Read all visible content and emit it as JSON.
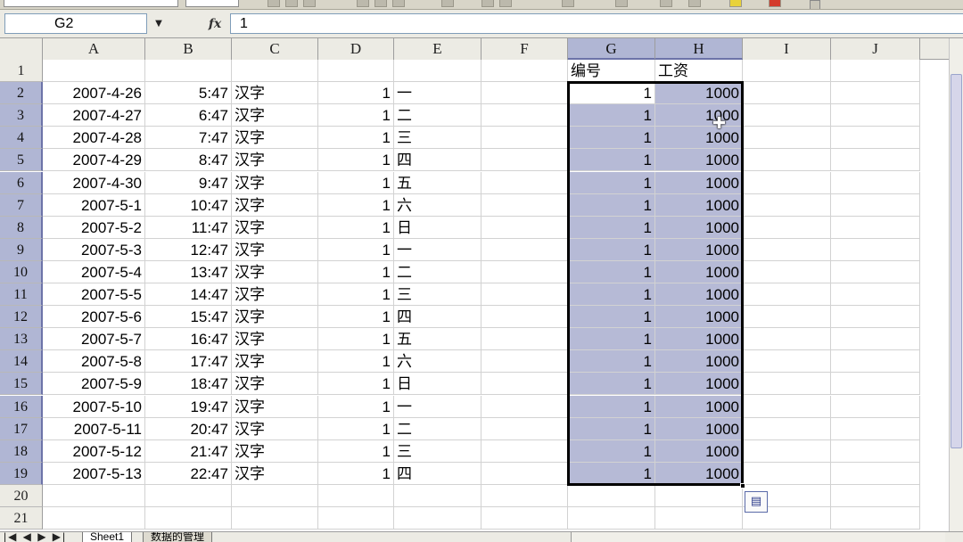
{
  "formula_bar": {
    "name_box": "G2",
    "name_box_arrow": "▼",
    "fx": "fx",
    "value": "1"
  },
  "columns": [
    "A",
    "B",
    "C",
    "D",
    "E",
    "F",
    "G",
    "H",
    "I",
    "J"
  ],
  "selected_columns": [
    "G",
    "H"
  ],
  "rows": [
    "1",
    "2",
    "3",
    "4",
    "5",
    "6",
    "7",
    "8",
    "9",
    "10",
    "11",
    "12",
    "13",
    "14",
    "15",
    "16",
    "17",
    "18",
    "19",
    "20",
    "21"
  ],
  "selected_rows": [
    "2",
    "3",
    "4",
    "5",
    "6",
    "7",
    "8",
    "9",
    "10",
    "11",
    "12",
    "13",
    "14",
    "15",
    "16",
    "17",
    "18",
    "19"
  ],
  "headers": {
    "G1": "编号",
    "H1": "工资"
  },
  "table_rows": [
    {
      "a": "2007-4-26",
      "b": "5:47",
      "c": "汉字",
      "d": "1",
      "e": "一",
      "g": "1",
      "h": "1000"
    },
    {
      "a": "2007-4-27",
      "b": "6:47",
      "c": "汉字",
      "d": "1",
      "e": "二",
      "g": "1",
      "h": "1000"
    },
    {
      "a": "2007-4-28",
      "b": "7:47",
      "c": "汉字",
      "d": "1",
      "e": "三",
      "g": "1",
      "h": "1000"
    },
    {
      "a": "2007-4-29",
      "b": "8:47",
      "c": "汉字",
      "d": "1",
      "e": "四",
      "g": "1",
      "h": "1000"
    },
    {
      "a": "2007-4-30",
      "b": "9:47",
      "c": "汉字",
      "d": "1",
      "e": "五",
      "g": "1",
      "h": "1000"
    },
    {
      "a": "2007-5-1",
      "b": "10:47",
      "c": "汉字",
      "d": "1",
      "e": "六",
      "g": "1",
      "h": "1000"
    },
    {
      "a": "2007-5-2",
      "b": "11:47",
      "c": "汉字",
      "d": "1",
      "e": "日",
      "g": "1",
      "h": "1000"
    },
    {
      "a": "2007-5-3",
      "b": "12:47",
      "c": "汉字",
      "d": "1",
      "e": "一",
      "g": "1",
      "h": "1000"
    },
    {
      "a": "2007-5-4",
      "b": "13:47",
      "c": "汉字",
      "d": "1",
      "e": "二",
      "g": "1",
      "h": "1000"
    },
    {
      "a": "2007-5-5",
      "b": "14:47",
      "c": "汉字",
      "d": "1",
      "e": "三",
      "g": "1",
      "h": "1000"
    },
    {
      "a": "2007-5-6",
      "b": "15:47",
      "c": "汉字",
      "d": "1",
      "e": "四",
      "g": "1",
      "h": "1000"
    },
    {
      "a": "2007-5-7",
      "b": "16:47",
      "c": "汉字",
      "d": "1",
      "e": "五",
      "g": "1",
      "h": "1000"
    },
    {
      "a": "2007-5-8",
      "b": "17:47",
      "c": "汉字",
      "d": "1",
      "e": "六",
      "g": "1",
      "h": "1000"
    },
    {
      "a": "2007-5-9",
      "b": "18:47",
      "c": "汉字",
      "d": "1",
      "e": "日",
      "g": "1",
      "h": "1000"
    },
    {
      "a": "2007-5-10",
      "b": "19:47",
      "c": "汉字",
      "d": "1",
      "e": "一",
      "g": "1",
      "h": "1000"
    },
    {
      "a": "2007-5-11",
      "b": "20:47",
      "c": "汉字",
      "d": "1",
      "e": "二",
      "g": "1",
      "h": "1000"
    },
    {
      "a": "2007-5-12",
      "b": "21:47",
      "c": "汉字",
      "d": "1",
      "e": "三",
      "g": "1",
      "h": "1000"
    },
    {
      "a": "2007-5-13",
      "b": "22:47",
      "c": "汉字",
      "d": "1",
      "e": "四",
      "g": "1",
      "h": "1000"
    }
  ],
  "selection": {
    "range": "G2:H19",
    "active_cell": "G2"
  },
  "icons": {
    "fill_handle": "fill-handle-icon",
    "paste_options": "paste-options-icon",
    "cursor": "plus-cursor-icon"
  },
  "paste_options_glyph": "▤",
  "cursor_glyph": "✚",
  "sheet_tabs": {
    "nav": "|◀ ◀ ▶ ▶|",
    "tabs": [
      "Sheet1",
      "数据的管理"
    ]
  },
  "colors": {
    "selection_fill": "#b6bad6",
    "header_bg": "#ecebe4",
    "selected_header": "#b0b6d4"
  }
}
